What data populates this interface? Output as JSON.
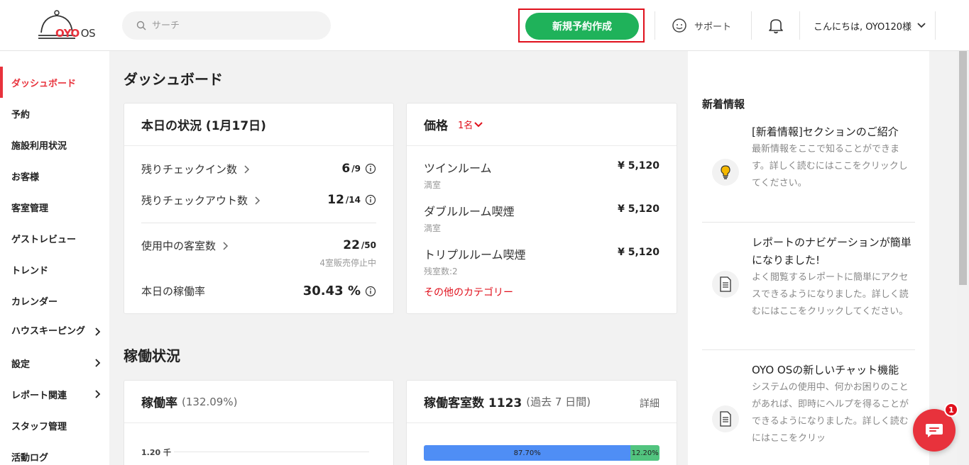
{
  "header": {
    "logo_brand": "OYO",
    "logo_suffix": "OS",
    "search_placeholder": "サーチ",
    "new_reservation_label": "新規予約作成",
    "support_label": "サポート",
    "greeting": "こんにちは, OYO120様"
  },
  "sidebar": {
    "items": [
      {
        "label": "ダッシュボード"
      },
      {
        "label": "予約"
      },
      {
        "label": "施設利用状況"
      },
      {
        "label": "お客様"
      },
      {
        "label": "客室管理"
      },
      {
        "label": "ゲストレビュー"
      },
      {
        "label": "トレンド"
      },
      {
        "label": "カレンダー"
      },
      {
        "label": "ハウスキーピング"
      },
      {
        "label": "設定"
      },
      {
        "label": "レポート関連"
      },
      {
        "label": "スタッフ管理"
      },
      {
        "label": "活動ログ"
      }
    ]
  },
  "main": {
    "title": "ダッシュボード",
    "today": {
      "title": "本日の状況 (1月17日)",
      "checkin_label": "残りチェックイン数",
      "checkin_value": "6",
      "checkin_total": "/9",
      "checkout_label": "残りチェックアウト数",
      "checkout_value": "12",
      "checkout_total": "/14",
      "rooms_label": "使用中の客室数",
      "rooms_value": "22",
      "rooms_total": "/50",
      "rooms_note": "4室販売停止中",
      "occupancy_label": "本日の稼働率",
      "occupancy_value": "30.43 %"
    },
    "price": {
      "title": "価格",
      "guest_count": "1名",
      "rooms": [
        {
          "name": "ツインルーム",
          "status": "満室",
          "price": "¥ 5,120"
        },
        {
          "name": "ダブルルーム喫煙",
          "status": "満室",
          "price": "¥ 5,120"
        },
        {
          "name": "トリプルルーム喫煙",
          "status": "残室数:2",
          "price": "¥ 5,120"
        }
      ],
      "other_categories": "その他のカテゴリー"
    },
    "operations_title": "稼働状況",
    "occupancy_card": {
      "title": "稼働率",
      "subtitle": "(132.09%)",
      "y_tick": "1.20 千"
    },
    "rooms_card": {
      "title": "稼働客室数 1123",
      "subtitle": "(過去 7 日間)",
      "detail": "詳細",
      "segments": [
        {
          "label": "87.70%",
          "value": 87.7,
          "color": "#4f8ef5"
        },
        {
          "label": "12.20%",
          "value": 12.2,
          "color": "#52c47f"
        }
      ]
    }
  },
  "news": {
    "title": "新着情報",
    "items": [
      {
        "icon": "lightbulb-icon",
        "heading": "[新着情報]セクションのご紹介",
        "body": "最新情報をここで知ることができます。詳しく読むにはここをクリックしてください。"
      },
      {
        "icon": "document-icon",
        "heading": "レポートのナビゲーションが簡単になりました!",
        "body": "よく閲覧するレポートに簡単にアクセスできるようになりました。詳しく読むにはここをクリックしてください。"
      },
      {
        "icon": "document-icon",
        "heading": "OYO OSの新しいチャット機能",
        "body": "システムの使用中、何かお困りのことがあれば、即時にヘルプを得ることができるようになりました。詳しく読むにはここをクリッ"
      }
    ]
  },
  "chat": {
    "badge_count": "1"
  }
}
